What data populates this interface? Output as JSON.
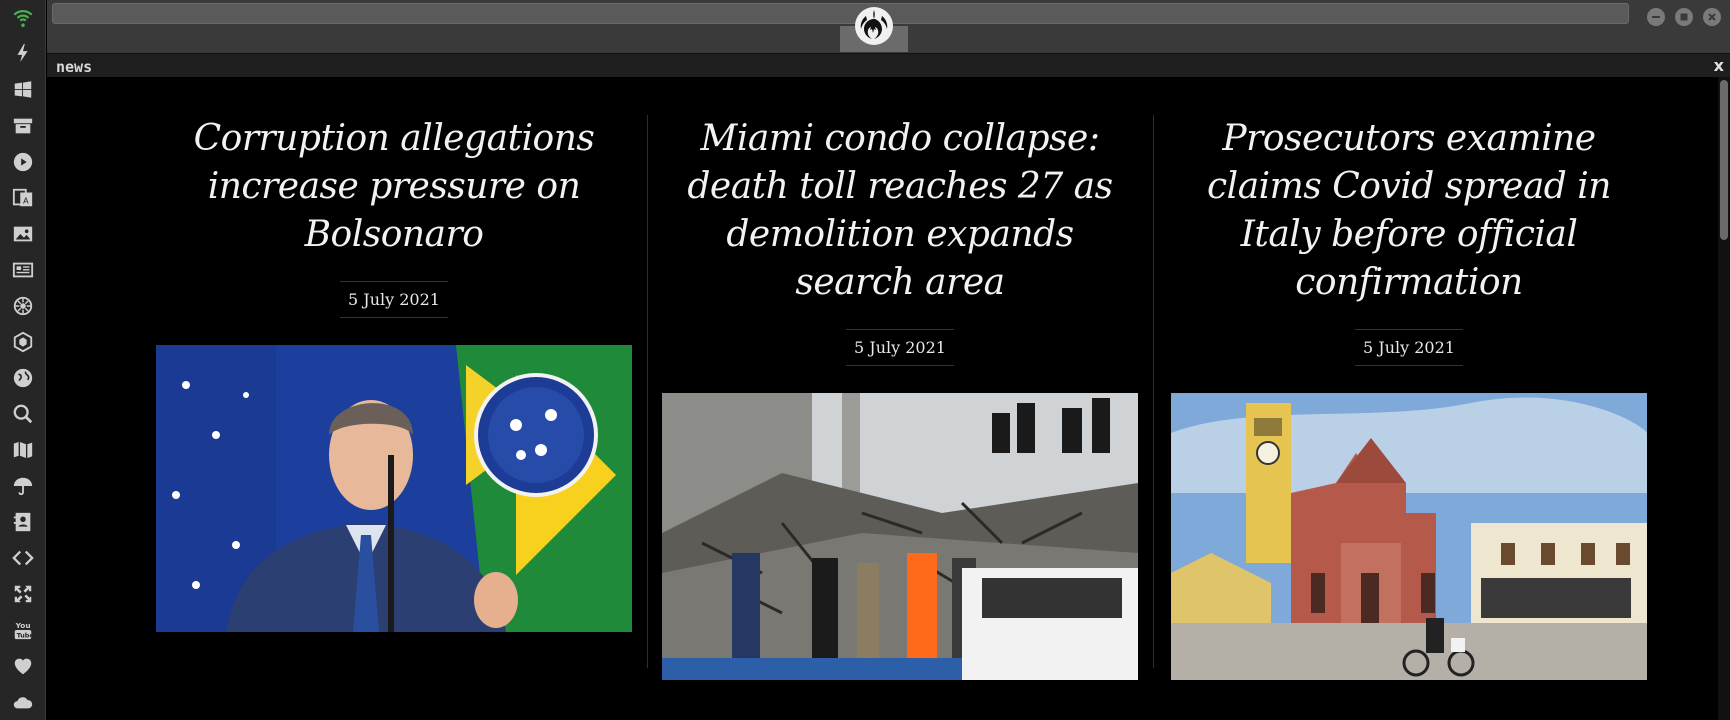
{
  "dock": {
    "icons": [
      "wifi-icon",
      "lightning-icon",
      "windows-icon",
      "archive-icon",
      "play-icon",
      "translate-icon",
      "image-icon",
      "newspaper-icon",
      "settings-cog-icon",
      "hexagon-icon",
      "globe-icon",
      "search-icon",
      "map-icon",
      "umbrella-icon",
      "contacts-icon",
      "code-icon",
      "expand-icon",
      "youtube-icon",
      "heart-icon",
      "cloud-icon"
    ],
    "active_color": "#4caf50"
  },
  "topbar": {
    "logo_icon": "rebel-alliance-logo-icon"
  },
  "panel": {
    "title": "news",
    "close_label": "x"
  },
  "articles": [
    {
      "headline": "Corruption allegations increase pressure on Bolsonaro",
      "date": "5 July 2021",
      "image_desc": "bolsonaro-photo"
    },
    {
      "headline": "Miami condo collapse: death toll reaches 27 as demolition expands search area",
      "date": "5 July 2021",
      "image_desc": "condo-collapse-photo"
    },
    {
      "headline": "Prosecutors examine claims Covid spread in Italy before official confirmation",
      "date": "5 July 2021",
      "image_desc": "italy-church-photo"
    }
  ]
}
